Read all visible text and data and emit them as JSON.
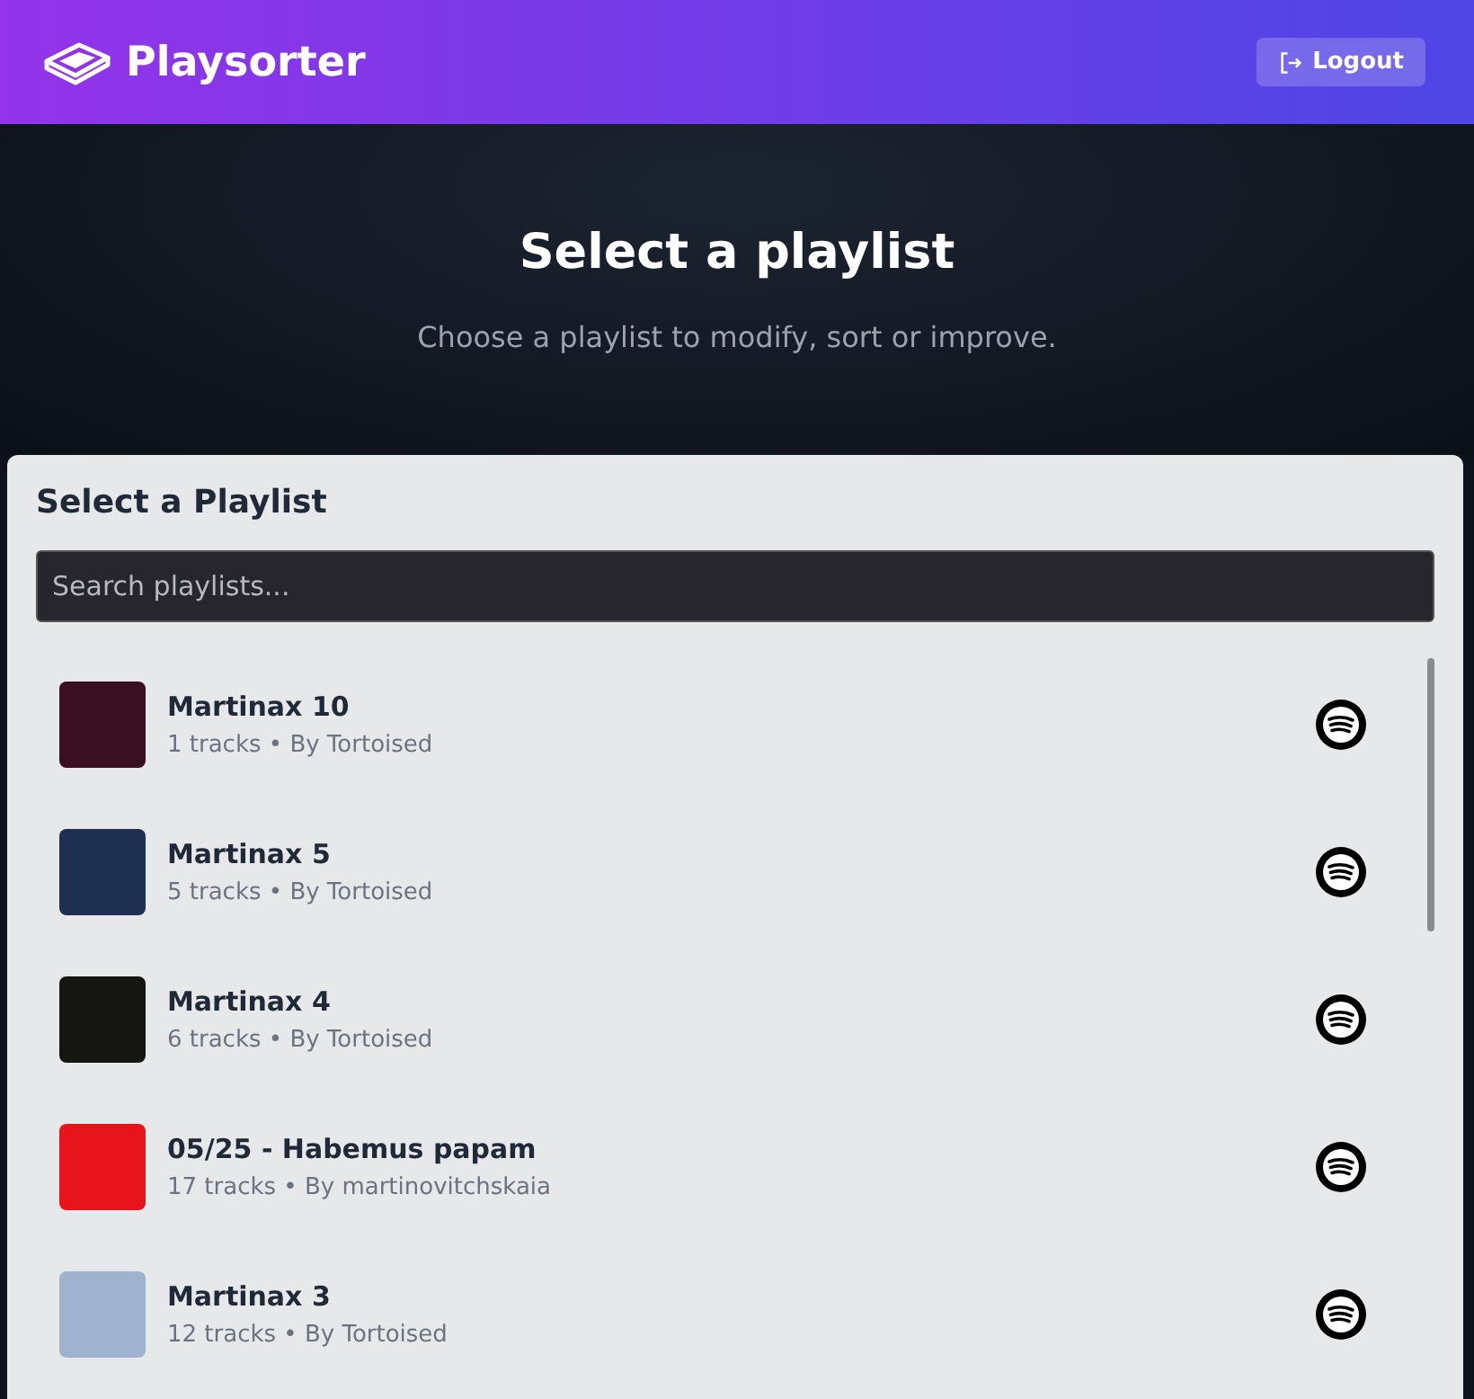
{
  "header": {
    "brand": "Playsorter",
    "logout": "Logout"
  },
  "hero": {
    "title": "Select a playlist",
    "subtitle": "Choose a playlist to modify, sort or improve."
  },
  "panel": {
    "title": "Select a Playlist",
    "search": {
      "placeholder": "Search playlists..."
    },
    "playlists": [
      {
        "name": "Martinax 10",
        "meta": "1 tracks • By Tortoised",
        "color": "#3a1020"
      },
      {
        "name": "Martinax 5",
        "meta": "5 tracks • By Tortoised",
        "color": "#1e2f52"
      },
      {
        "name": "Martinax 4",
        "meta": "6 tracks • By Tortoised",
        "color": "#151512"
      },
      {
        "name": "05/25 - Habemus papam",
        "meta": "17 tracks • By martinovitchskaia",
        "color": "#e8141c"
      },
      {
        "name": "Martinax 3",
        "meta": "12 tracks • By Tortoised",
        "color": "#9fb3cf"
      }
    ]
  }
}
